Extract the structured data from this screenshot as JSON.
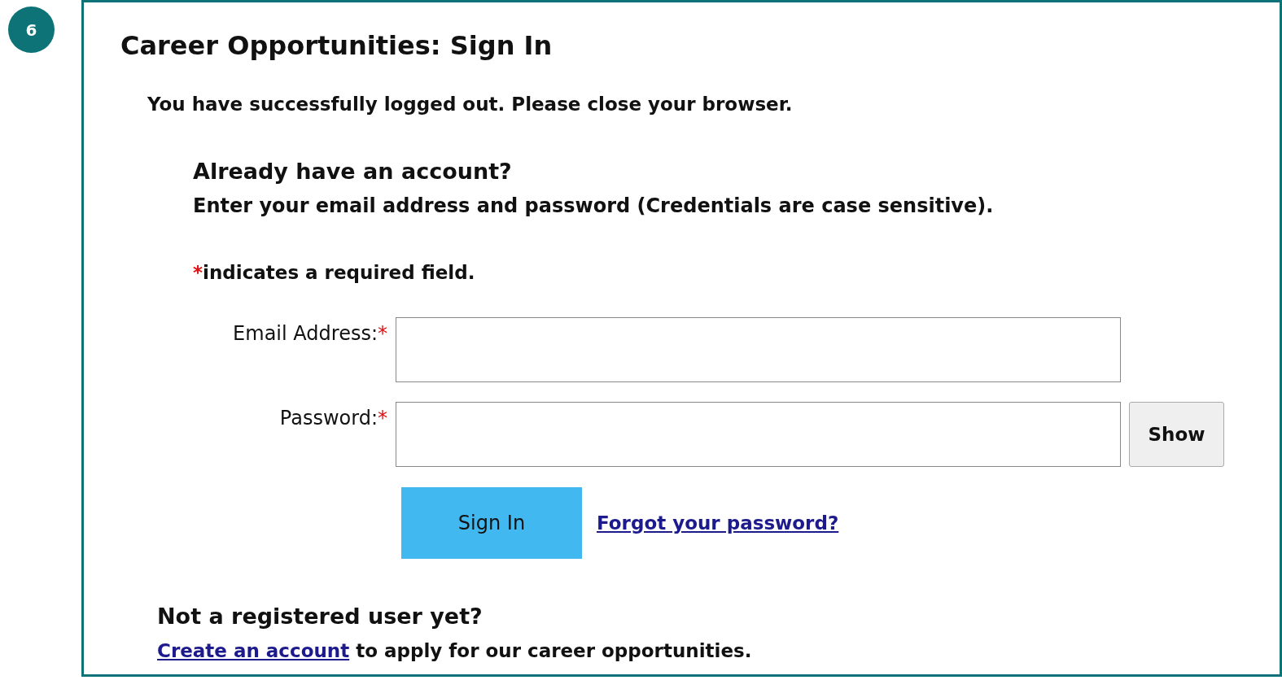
{
  "step_badge": "6",
  "title": "Career Opportunities: Sign In",
  "message": "You have successfully logged out. Please close your browser.",
  "account": {
    "heading": "Already have an account?",
    "instructions": "Enter your email address and password (Credentials are case sensitive).",
    "required_mark": "*",
    "required_note": "indicates a required field."
  },
  "fields": [
    {
      "label": "Email Address:",
      "required_mark": "*"
    },
    {
      "label": "Password:",
      "required_mark": "*",
      "button": "Show"
    }
  ],
  "sign_in_button": "Sign In",
  "forgot_link": "Forgot your password?",
  "register": {
    "heading": "Not a registered user yet?",
    "link": "Create an account",
    "text": " to apply for our career opportunities."
  }
}
